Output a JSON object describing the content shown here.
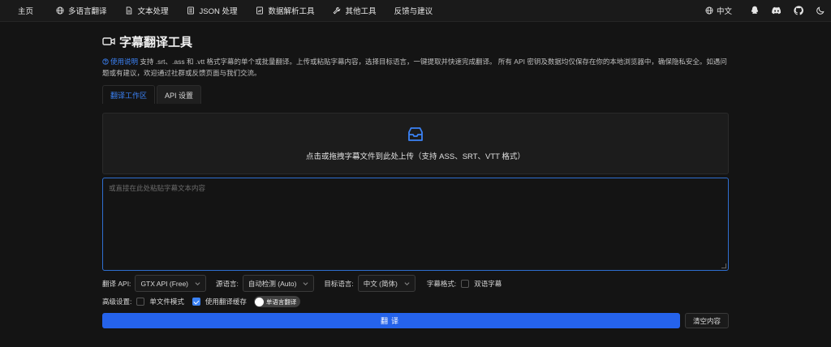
{
  "nav": {
    "home": "主页",
    "multilang": "多语言翻译",
    "text": "文本处理",
    "json": "JSON 处理",
    "data": "数据解析工具",
    "other": "其他工具",
    "feedback": "反馈与建议",
    "language": "中文"
  },
  "page": {
    "title": "字幕翻译工具",
    "desc_link": "使用说明",
    "desc_text": " 支持 .srt、.ass 和 .vtt 格式字幕的单个或批量翻译。上传或粘贴字幕内容，选择目标语言，一键提取并快速完成翻译。 所有 API 密钥及数据均仅保存在你的本地浏览器中，确保隐私安全。如遇问题或有建议，欢迎通过社群或反馈页面与我们交流。"
  },
  "tabs": {
    "workspace": "翻译工作区",
    "api": "API 设置"
  },
  "upload": {
    "text": "点击或拖拽字幕文件到此处上传（支持 ASS、SRT、VTT 格式）"
  },
  "paste": {
    "placeholder": "或直接在此处粘贴字幕文本内容"
  },
  "options": {
    "api_label": "翻译 API:",
    "api_value": "GTX API (Free)",
    "source_label": "源语言:",
    "source_value": "自动检测 (Auto)",
    "target_label": "目标语言:",
    "target_value": "中文 (简体)",
    "format_label": "字幕格式:",
    "bilingual_label": "双语字幕",
    "bilingual_checked": false
  },
  "advanced": {
    "label": "高级设置:",
    "single_file_label": "单文件模式",
    "single_file_checked": false,
    "cache_label": "使用翻译缓存",
    "cache_checked": true,
    "mode_toggle_label": "单语言翻译"
  },
  "actions": {
    "translate": "翻译",
    "clear": "清空内容"
  },
  "colors": {
    "accent": "#2563eb",
    "link": "#3b82f6",
    "background": "#141414"
  }
}
